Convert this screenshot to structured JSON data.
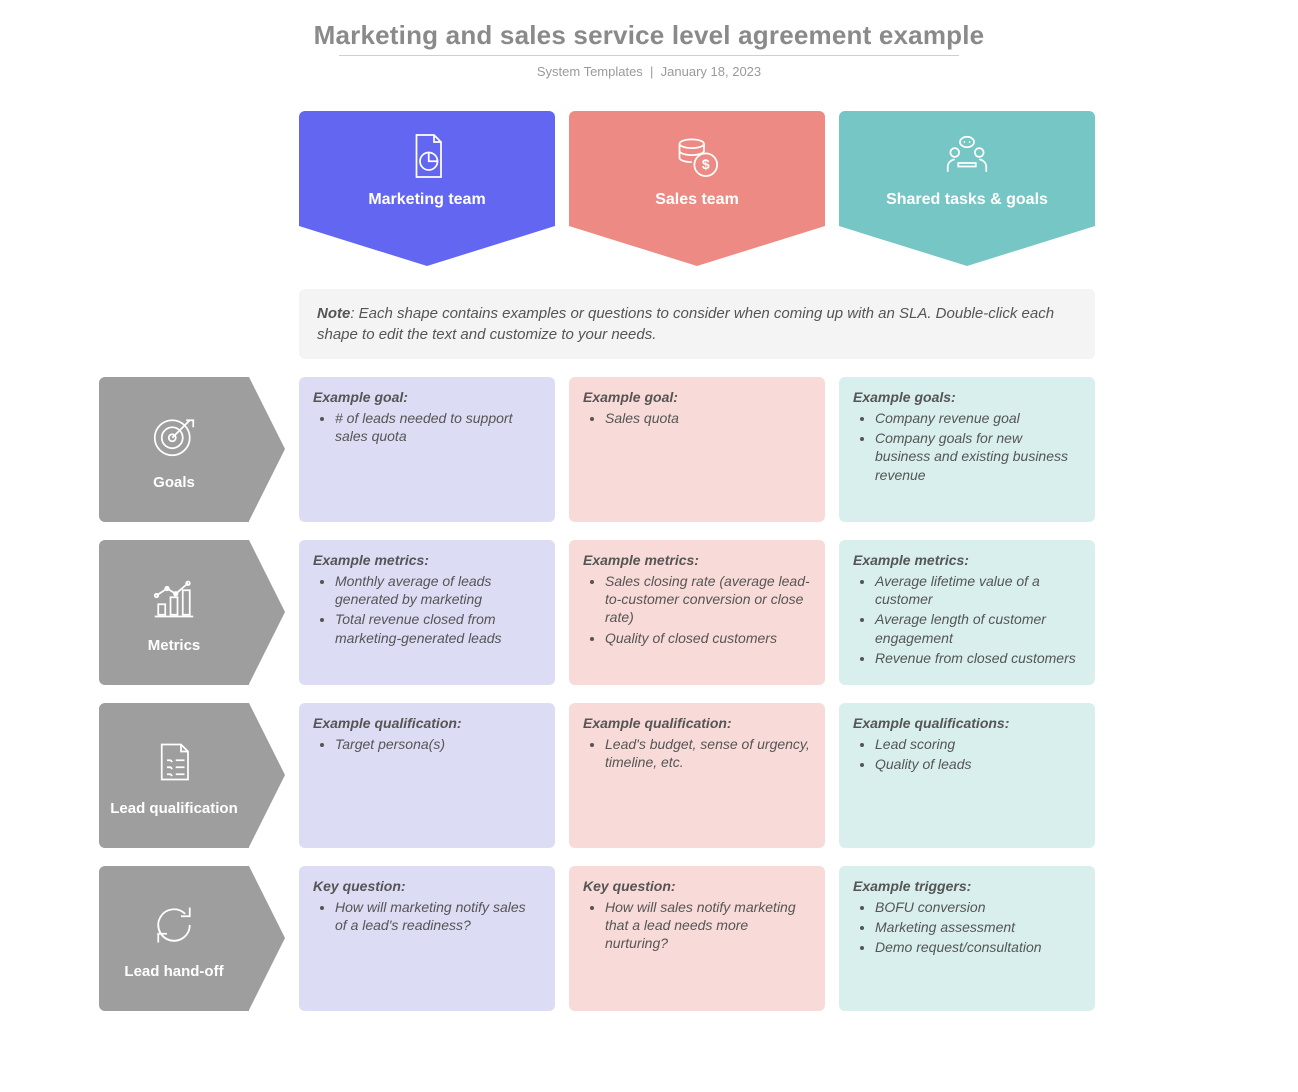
{
  "header": {
    "title": "Marketing and sales service level agreement example",
    "source": "System Templates",
    "sep": "|",
    "date": "January 18, 2023"
  },
  "columns": [
    {
      "label": "Marketing team"
    },
    {
      "label": "Sales team"
    },
    {
      "label": "Shared tasks & goals"
    }
  ],
  "note": {
    "label": "Note",
    "text": ": Each shape contains examples or questions to consider when coming up with an SLA. Double-click each shape to edit the text and customize to your needs."
  },
  "rows": [
    {
      "label": "Goals",
      "cells": [
        {
          "lead": "Example goal:",
          "items": [
            "# of leads needed to support sales quota"
          ]
        },
        {
          "lead": "Example goal:",
          "items": [
            "Sales quota"
          ]
        },
        {
          "lead": "Example goals:",
          "items": [
            "Company revenue goal",
            "Company goals for new business and existing business revenue"
          ]
        }
      ]
    },
    {
      "label": "Metrics",
      "cells": [
        {
          "lead": "Example metrics:",
          "items": [
            "Monthly average of leads generated by marketing",
            "Total revenue closed from marketing-generated leads"
          ]
        },
        {
          "lead": "Example metrics:",
          "items": [
            "Sales closing rate (average lead-to-customer conversion or close rate)",
            "Quality of closed customers"
          ]
        },
        {
          "lead": "Example metrics:",
          "items": [
            "Average lifetime value of a customer",
            "Average length of customer engagement",
            "Revenue from closed customers"
          ]
        }
      ]
    },
    {
      "label": "Lead qualification",
      "cells": [
        {
          "lead": "Example qualification:",
          "items": [
            "Target persona(s)"
          ]
        },
        {
          "lead": "Example qualification:",
          "items": [
            "Lead's budget, sense of urgency, timeline, etc."
          ]
        },
        {
          "lead": "Example qualifications:",
          "items": [
            "Lead scoring",
            "Quality of leads"
          ]
        }
      ]
    },
    {
      "label": "Lead hand-off",
      "cells": [
        {
          "lead": "Key question:",
          "items": [
            "How will marketing notify sales of a lead's readiness?"
          ]
        },
        {
          "lead": "Key question:",
          "items": [
            "How will sales notify marketing that a lead needs more nurturing?"
          ]
        },
        {
          "lead": "Example triggers:",
          "items": [
            "BOFU conversion",
            "Marketing assessment",
            "Demo request/consultation"
          ]
        }
      ]
    }
  ]
}
